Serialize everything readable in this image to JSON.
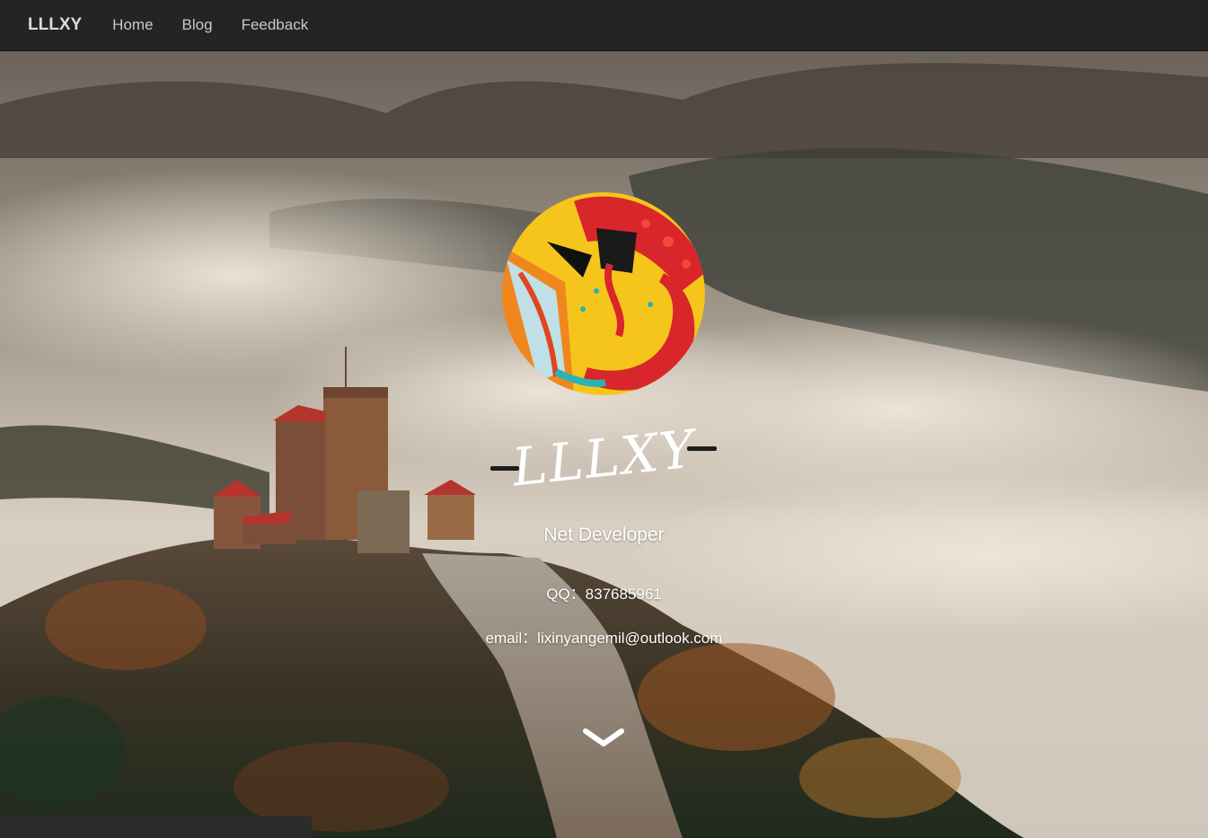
{
  "nav": {
    "brand": "LLLXY",
    "links": [
      "Home",
      "Blog",
      "Feedback"
    ]
  },
  "hero": {
    "title": "LLLXY",
    "role": "Net Developer",
    "qq": "QQ：837685961",
    "email": "email：lixinyangemil@outlook.com"
  },
  "icons": {
    "scroll": "chevron-down-icon",
    "avatar": "cartoon-avatar"
  },
  "colors": {
    "navbar": "#222426",
    "text": "#ffffff",
    "avatar_yellow": "#f6c51c",
    "avatar_red": "#d8262b"
  }
}
